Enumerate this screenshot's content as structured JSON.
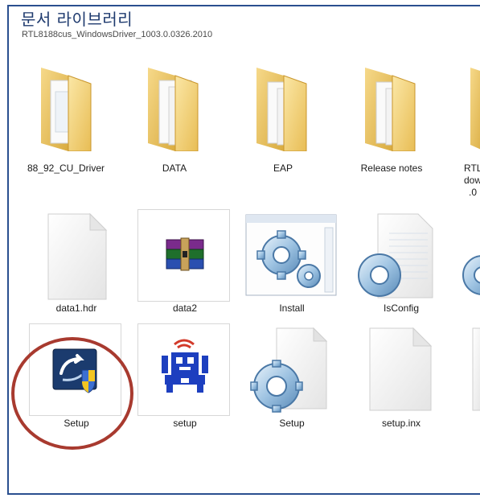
{
  "header": {
    "title": "문서 라이브러리",
    "path": "RTL8188cus_WindowsDriver_1003.0.0326.2010"
  },
  "row1": [
    {
      "label": "88_92_CU_Driver",
      "icon": "folder-with-documents-icon"
    },
    {
      "label": "DATA",
      "icon": "folder-with-documents-icon"
    },
    {
      "label": "EAP",
      "icon": "folder-with-documents-icon"
    },
    {
      "label": "Release notes",
      "icon": "folder-with-documents-icon"
    },
    {
      "label": "RTL",
      "label2": "dow",
      "label3": ".0",
      "icon": "folder-with-documents-icon"
    }
  ],
  "row2": [
    {
      "label": "data1.hdr",
      "icon": "blank-file-icon"
    },
    {
      "label": "data2",
      "icon": "winrar-archive-icon"
    },
    {
      "label": "Install",
      "icon": "gear-application-icon"
    },
    {
      "label": "IsConfig",
      "icon": "gear-file-icon"
    },
    {
      "label": "",
      "icon": "gear-file-icon"
    }
  ],
  "row3": [
    {
      "label": "Setup",
      "icon": "setup-shield-icon"
    },
    {
      "label": "setup",
      "icon": "robot-setup-icon"
    },
    {
      "label": "Setup",
      "icon": "gear-file-icon"
    },
    {
      "label": "setup.inx",
      "icon": "blank-file-icon"
    }
  ],
  "colors": {
    "frame_border": "#2a4f8f",
    "title_text": "#1e3a6e",
    "highlight_circle": "#a83a2f",
    "folder_yellow": "#f2cf6c"
  }
}
